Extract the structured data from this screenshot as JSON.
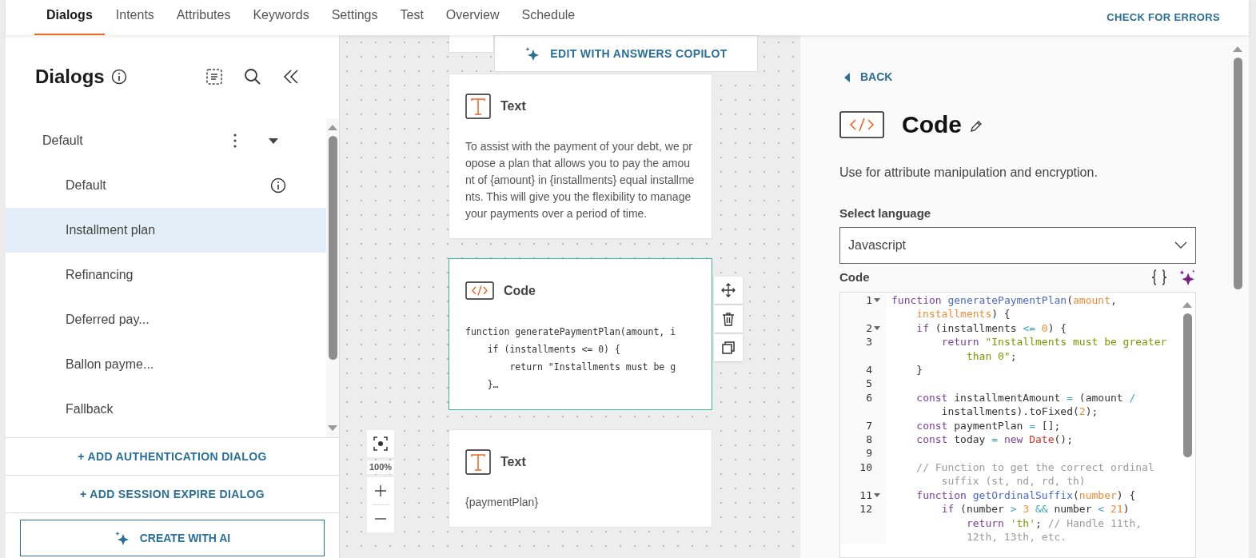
{
  "nav": {
    "tabs": [
      {
        "label": "Dialogs",
        "selected": true
      },
      {
        "label": "Intents",
        "selected": false
      },
      {
        "label": "Attributes",
        "selected": false
      },
      {
        "label": "Keywords",
        "selected": false
      },
      {
        "label": "Settings",
        "selected": false
      },
      {
        "label": "Test",
        "selected": false
      },
      {
        "label": "Overview",
        "selected": false
      },
      {
        "label": "Schedule",
        "selected": false
      }
    ],
    "action": "CHECK FOR ERRORS"
  },
  "sidebar": {
    "title": "Dialogs",
    "groups": [
      {
        "label": "Default",
        "expanded": true,
        "children": [
          {
            "label": "Default",
            "selected": false,
            "info": true
          },
          {
            "label": "Installment plan",
            "selected": true,
            "info": false
          },
          {
            "label": "Refinancing",
            "selected": false,
            "info": false
          },
          {
            "label": "Deferred pay...",
            "selected": false,
            "info": false
          },
          {
            "label": "Ballon payme...",
            "selected": false,
            "info": false
          },
          {
            "label": "Fallback",
            "selected": false,
            "info": false
          }
        ]
      }
    ],
    "actions": [
      "+ ADD AUTHENTICATION DIALOG",
      "+ ADD SESSION EXPIRE DIALOG"
    ],
    "create_button": "CREATE WITH AI"
  },
  "canvas": {
    "copilot_button": "EDIT WITH ANSWERS COPILOT",
    "zoom": "100%",
    "nodes": [
      {
        "kind": "text",
        "title": "Text",
        "selected": false,
        "body": "To assist with the payment of your debt, we propose a plan that allows you to pay the amount of {amount} in {installments} equal installments. This will give you the flexibility to manage your payments over a period of time."
      },
      {
        "kind": "code",
        "title": "Code",
        "selected": true,
        "lines": [
          "function generatePaymentPlan(amount, i",
          "    if (installments <= 0) {",
          "        return \"Installments must be g",
          "    }…"
        ]
      },
      {
        "kind": "text",
        "title": "Text",
        "selected": false,
        "body": "{paymentPlan}"
      }
    ]
  },
  "panel": {
    "back": "BACK",
    "title": "Code",
    "description": "Use for attribute manipulation and encryption.",
    "language_label": "Select language",
    "language": "Javascript",
    "code_label": "Code",
    "code_lines": [
      {
        "number": "1",
        "foldable": true,
        "tokens": [
          {
            "kind": "keyword",
            "text": "function "
          },
          {
            "kind": "function",
            "text": "generatePaymentPlan"
          },
          {
            "kind": "plain",
            "text": "("
          },
          {
            "kind": "param",
            "text": "amount"
          },
          {
            "kind": "plain",
            "text": ", "
          },
          {
            "kind": "param",
            "text": "installments"
          },
          {
            "kind": "plain",
            "text": ") {"
          }
        ]
      },
      {
        "number": "2",
        "foldable": true,
        "tokens": [
          {
            "kind": "keyword",
            "text": "    if"
          },
          {
            "kind": "plain",
            "text": " (installments "
          },
          {
            "kind": "operator",
            "text": "<= "
          },
          {
            "kind": "number",
            "text": "0"
          },
          {
            "kind": "plain",
            "text": ") {"
          }
        ]
      },
      {
        "number": "3",
        "foldable": false,
        "tokens": [
          {
            "kind": "keyword",
            "text": "        return "
          },
          {
            "kind": "string",
            "text": "\"Installments must be greater than 0\""
          },
          {
            "kind": "plain",
            "text": ";"
          }
        ]
      },
      {
        "number": "4",
        "foldable": false,
        "tokens": [
          {
            "kind": "plain",
            "text": "    }"
          }
        ]
      },
      {
        "number": "5",
        "foldable": false
      },
      {
        "number": "6",
        "foldable": false,
        "tokens": [
          {
            "kind": "keyword",
            "text": "    const"
          },
          {
            "kind": "plain",
            "text": " installmentAmount "
          },
          {
            "kind": "operator",
            "text": "="
          },
          {
            "kind": "plain",
            "text": " (amount "
          },
          {
            "kind": "operator",
            "text": "/"
          },
          {
            "kind": "plain",
            "text": " installments).toFixed("
          },
          {
            "kind": "number",
            "text": "2"
          },
          {
            "kind": "plain",
            "text": ");"
          }
        ]
      },
      {
        "number": "7",
        "foldable": false,
        "tokens": [
          {
            "kind": "keyword",
            "text": "    const"
          },
          {
            "kind": "plain",
            "text": " paymentPlan "
          },
          {
            "kind": "operator",
            "text": "="
          },
          {
            "kind": "plain",
            "text": " [];"
          }
        ]
      },
      {
        "number": "8",
        "foldable": false,
        "tokens": [
          {
            "kind": "keyword",
            "text": "    const"
          },
          {
            "kind": "plain",
            "text": " today "
          },
          {
            "kind": "operator",
            "text": "= "
          },
          {
            "kind": "keyword",
            "text": "new "
          },
          {
            "kind": "builtin",
            "text": "Date"
          },
          {
            "kind": "plain",
            "text": "();"
          }
        ]
      },
      {
        "number": "9",
        "foldable": false
      },
      {
        "number": "10",
        "foldable": false,
        "tokens": [
          {
            "kind": "comment",
            "text": "    // Function to get the correct ordinal suffix (st, nd, rd, th)"
          }
        ]
      },
      {
        "number": "11",
        "foldable": true,
        "tokens": [
          {
            "kind": "keyword",
            "text": "    function "
          },
          {
            "kind": "function",
            "text": "getOrdinalSuffix"
          },
          {
            "kind": "plain",
            "text": "("
          },
          {
            "kind": "param",
            "text": "number"
          },
          {
            "kind": "plain",
            "text": ") {"
          }
        ]
      },
      {
        "number": "12",
        "foldable": false,
        "tokens": [
          {
            "kind": "keyword",
            "text": "        if"
          },
          {
            "kind": "plain",
            "text": " (number "
          },
          {
            "kind": "operator",
            "text": "> "
          },
          {
            "kind": "number",
            "text": "3"
          },
          {
            "kind": "operator",
            "text": " && "
          },
          {
            "kind": "plain",
            "text": "number "
          },
          {
            "kind": "operator",
            "text": "< "
          },
          {
            "kind": "number",
            "text": "21"
          },
          {
            "kind": "plain",
            "text": ") "
          },
          {
            "kind": "keyword",
            "text": "return "
          },
          {
            "kind": "string",
            "text": "'th'"
          },
          {
            "kind": "plain",
            "text": "; "
          },
          {
            "kind": "comment",
            "text": "// Handle 11th, 12th, 13th, etc."
          }
        ]
      }
    ]
  }
}
